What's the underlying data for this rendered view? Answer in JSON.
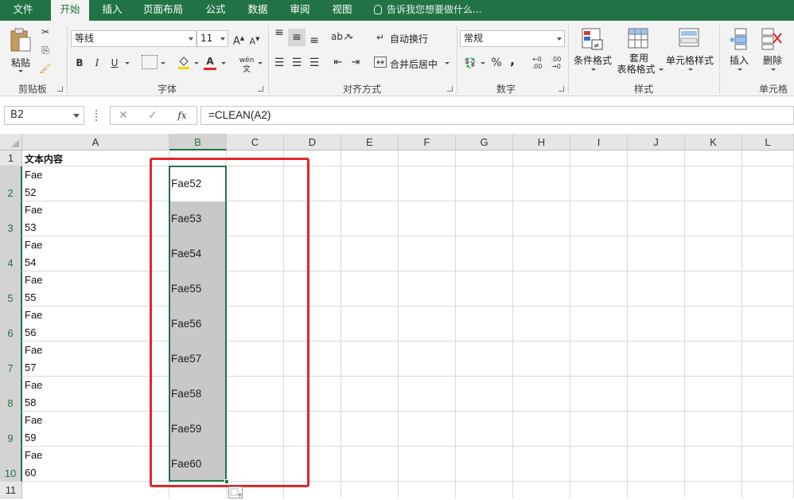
{
  "menu": {
    "tabs": [
      "文件",
      "开始",
      "插入",
      "页面布局",
      "公式",
      "数据",
      "审阅",
      "视图"
    ],
    "active_index": 1,
    "tell_me": "告诉我您想要做什么..."
  },
  "ribbon": {
    "clipboard": {
      "paste": "粘贴",
      "label": "剪贴板"
    },
    "font": {
      "name": "等线",
      "size": "11",
      "label": "字体",
      "bold": "B",
      "italic": "I",
      "underline": "U",
      "font_color_glyph": "A",
      "phonetic": "wén"
    },
    "alignment": {
      "wrap": "自动换行",
      "merge": "合并后居中",
      "label": "对齐方式"
    },
    "number": {
      "format": "常规",
      "percent": "%",
      "comma": ",",
      "inc_decimal": "←0 .00",
      "dec_decimal": ".00 →0",
      "label": "数字"
    },
    "styles": {
      "conditional": "条件格式",
      "table_1": "套用",
      "table_2": "表格格式",
      "cell_styles": "单元格样式",
      "label": "样式"
    },
    "cells": {
      "insert": "插入",
      "delete": "删除",
      "label": "单元格"
    }
  },
  "formula_bar": {
    "name_box": "B2",
    "formula": "=CLEAN(A2)",
    "fx": "fx"
  },
  "columns": [
    "A",
    "B",
    "C",
    "D",
    "E",
    "F",
    "G",
    "H",
    "I",
    "J",
    "K",
    "L"
  ],
  "selected_column": "B",
  "rows": [
    "1",
    "2",
    "3",
    "4",
    "5",
    "6",
    "7",
    "8",
    "9",
    "10",
    "11"
  ],
  "sheet": {
    "a1": "文本内容",
    "a_cells": [
      [
        "Fae",
        "52"
      ],
      [
        "Fae",
        "53"
      ],
      [
        "Fae",
        "54"
      ],
      [
        "Fae",
        "55"
      ],
      [
        "Fae",
        "56"
      ],
      [
        "Fae",
        "57"
      ],
      [
        "Fae",
        "58"
      ],
      [
        "Fae",
        "59"
      ],
      [
        "Fae",
        "60"
      ]
    ],
    "b_cells": [
      "Fae52",
      "Fae53",
      "Fae54",
      "Fae55",
      "Fae56",
      "Fae57",
      "Fae58",
      "Fae59",
      "Fae60"
    ]
  },
  "colors": {
    "excel_green": "#217346",
    "highlight_red": "#e0272b",
    "selection_fill": "#c8c8c8"
  }
}
